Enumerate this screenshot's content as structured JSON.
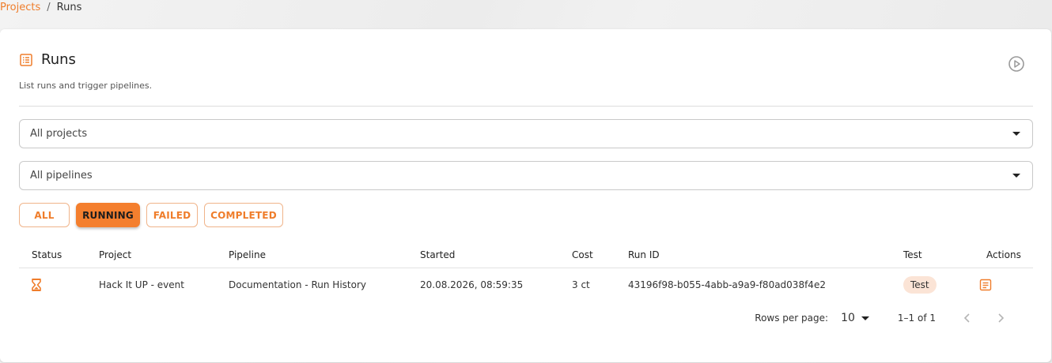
{
  "breadcrumb": {
    "parent": "Projects",
    "separator": "/",
    "current": "Runs"
  },
  "header": {
    "title": "Runs",
    "subtitle": "List runs and trigger pipelines.",
    "title_icon": "list-icon",
    "action_icon": "play-circle-icon"
  },
  "filters": {
    "project_select": {
      "value": "All projects"
    },
    "pipeline_select": {
      "value": "All pipelines"
    },
    "status_chips": [
      {
        "label": "ALL",
        "selected": false
      },
      {
        "label": "RUNNING",
        "selected": true
      },
      {
        "label": "FAILED",
        "selected": false
      },
      {
        "label": "COMPLETED",
        "selected": false
      }
    ]
  },
  "table": {
    "columns": [
      "Status",
      "Project",
      "Pipeline",
      "Started",
      "Cost",
      "Run ID",
      "Test",
      "Actions"
    ],
    "rows": [
      {
        "status_icon": "hourglass-icon",
        "project": "Hack It UP - event",
        "pipeline": "Documentation - Run History",
        "started": "20.08.2026, 08:59:35",
        "cost": "3 ct",
        "run_id": "43196f98-b055-4abb-a9a9-f80ad038f4e2",
        "test": "Test",
        "action_icon": "details-icon"
      }
    ]
  },
  "pagination": {
    "rows_label": "Rows per page:",
    "rows_value": "10",
    "range": "1–1 of 1"
  },
  "colors": {
    "accent": "#f47f2e",
    "badge_bg": "#fbe4d6"
  }
}
